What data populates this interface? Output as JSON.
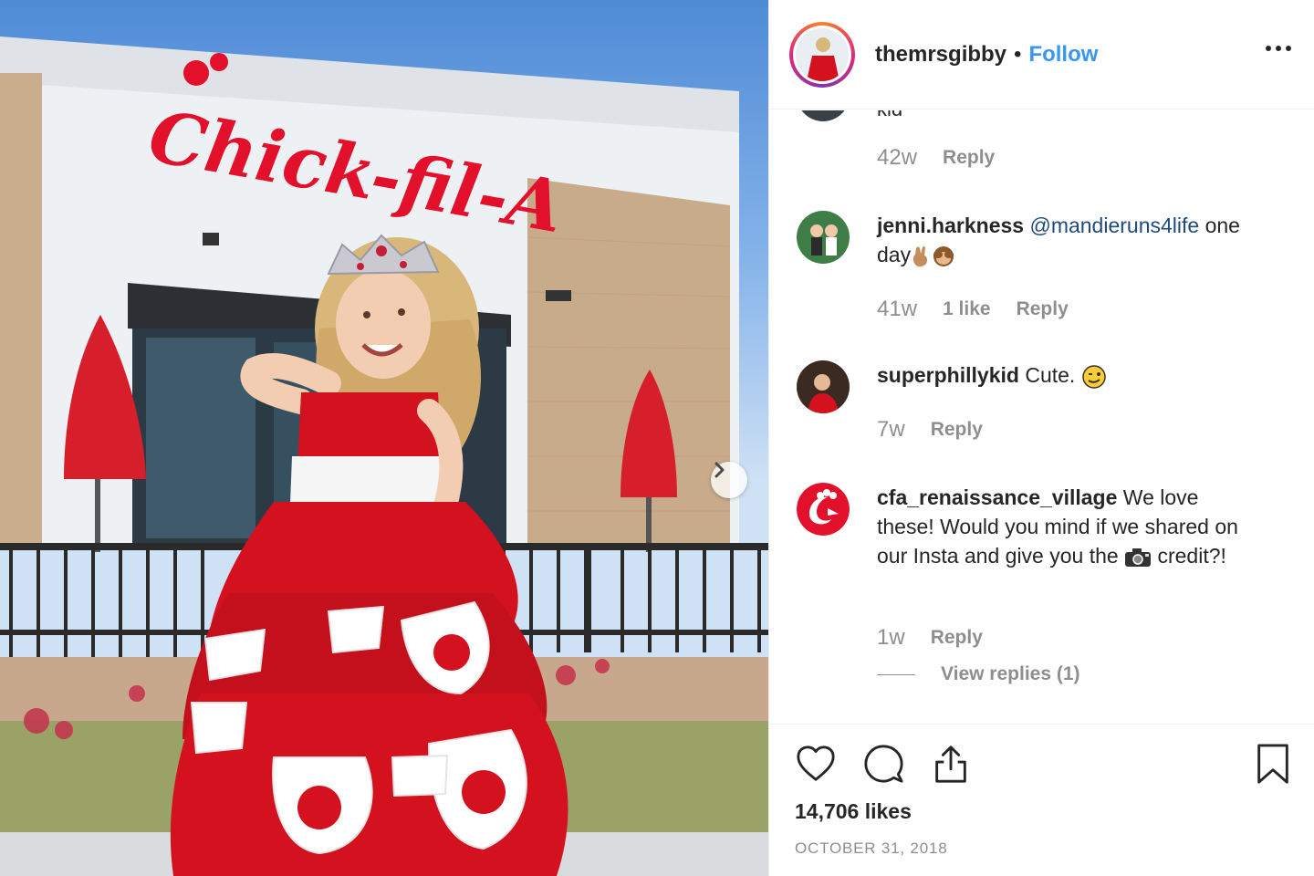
{
  "post": {
    "photo_alt": "",
    "sign_text": "Chick-fil-A"
  },
  "header": {
    "username": "themrsgibby",
    "separator": "•",
    "follow_label": "Follow"
  },
  "comments": {
    "cut_comment": {
      "text_fragment": "kid",
      "time": "42w",
      "reply_label": "Reply"
    },
    "items": [
      {
        "username": "jenni.harkness",
        "mention": "@mandieruns4life",
        "text": "one",
        "text2": "day",
        "time": "41w",
        "likes": "1 like",
        "reply_label": "Reply"
      },
      {
        "username": "superphillykid",
        "text": "Cute.",
        "time": "7w",
        "reply_label": "Reply"
      },
      {
        "username": "cfa_renaissance_village",
        "text": "We love these! Would you mind if we shared on our Insta and give you the",
        "text_end": "credit?!",
        "time": "1w",
        "reply_label": "Reply",
        "view_replies_label": "View replies (1)"
      }
    ]
  },
  "actions": {
    "icons": [
      "heart-icon",
      "comment-icon",
      "share-icon",
      "bookmark-icon"
    ],
    "likes_label": "14,706 likes",
    "date_label": "OCTOBER 31, 2018"
  },
  "colors": {
    "link_blue": "#3897f0",
    "mention_blue": "#1e4a7c",
    "muted_gray": "#8e8e8e",
    "brand_red": "#e3102b"
  }
}
